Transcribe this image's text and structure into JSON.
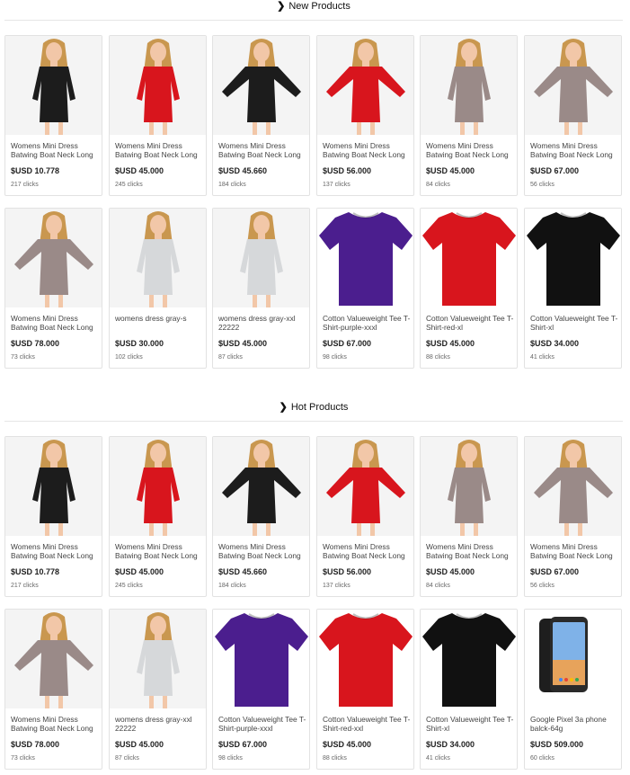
{
  "sections": [
    {
      "title": "New Products",
      "rows": [
        [
          {
            "name": "Womens Mini Dress Batwing Boat Neck Long",
            "price": "$USD 10.778",
            "clicks": "217 clicks",
            "thumb": "dress",
            "color": "#1c1c1c",
            "icon": "black-dress-image"
          },
          {
            "name": "Womens Mini Dress Batwing Boat Neck Long",
            "price": "$USD 45.000",
            "clicks": "245 clicks",
            "thumb": "dress",
            "color": "#d8151d",
            "icon": "red-dress-image"
          },
          {
            "name": "Womens Mini Dress Batwing Boat Neck Long",
            "price": "$USD 45.660",
            "clicks": "184 clicks",
            "thumb": "dress-wide",
            "color": "#1c1c1c",
            "icon": "black-batwing-dress-image"
          },
          {
            "name": "Womens Mini Dress Batwing Boat Neck Long",
            "price": "$USD 56.000",
            "clicks": "137 clicks",
            "thumb": "dress-wide",
            "color": "#d8151d",
            "icon": "red-batwing-dress-image"
          },
          {
            "name": "Womens Mini Dress Batwing Boat Neck Long",
            "price": "$USD 45.000",
            "clicks": "84 clicks",
            "thumb": "dress",
            "color": "#9a8a88",
            "icon": "taupe-dress-image"
          },
          {
            "name": "Womens Mini Dress Batwing Boat Neck Long",
            "price": "$USD 67.000",
            "clicks": "56 clicks",
            "thumb": "dress-wide",
            "color": "#9a8a88",
            "icon": "taupe-batwing-dress-image"
          }
        ],
        [
          {
            "name": "Womens Mini Dress Batwing Boat Neck Long",
            "price": "$USD 78.000",
            "clicks": "73 clicks",
            "thumb": "dress-wide",
            "color": "#9a8a88",
            "icon": "taupe-dress-back-image"
          },
          {
            "name": "womens dress gray-s",
            "price": "$USD 30.000",
            "clicks": "102 clicks",
            "thumb": "dress",
            "color": "#d6d8da",
            "icon": "gray-dress-image"
          },
          {
            "name": "womens dress gray-xxl 22222",
            "price": "$USD 45.000",
            "clicks": "87 clicks",
            "thumb": "dress",
            "color": "#d6d8da",
            "icon": "gray-dress-image"
          },
          {
            "name": "Cotton Valueweight Tee T-Shirt-purple-xxxl",
            "price": "$USD 67.000",
            "clicks": "98 clicks",
            "thumb": "tshirt",
            "color": "#4b1e8e",
            "icon": "purple-tshirt-image"
          },
          {
            "name": "Cotton Valueweight Tee T-Shirt-red-xl",
            "price": "$USD 45.000",
            "clicks": "88 clicks",
            "thumb": "tshirt",
            "color": "#d8151d",
            "icon": "red-tshirt-image"
          },
          {
            "name": "Cotton Valueweight Tee T-Shirt-xl",
            "price": "$USD 34.000",
            "clicks": "41 clicks",
            "thumb": "tshirt",
            "color": "#111111",
            "icon": "black-tshirt-image"
          }
        ]
      ]
    },
    {
      "title": "Hot Products",
      "rows": [
        [
          {
            "name": "Womens Mini Dress Batwing Boat Neck Long",
            "price": "$USD 10.778",
            "clicks": "217 clicks",
            "thumb": "dress",
            "color": "#1c1c1c",
            "icon": "black-dress-image"
          },
          {
            "name": "Womens Mini Dress Batwing Boat Neck Long",
            "price": "$USD 45.000",
            "clicks": "245 clicks",
            "thumb": "dress",
            "color": "#d8151d",
            "icon": "red-dress-image"
          },
          {
            "name": "Womens Mini Dress Batwing Boat Neck Long",
            "price": "$USD 45.660",
            "clicks": "184 clicks",
            "thumb": "dress-wide",
            "color": "#1c1c1c",
            "icon": "black-batwing-dress-image"
          },
          {
            "name": "Womens Mini Dress Batwing Boat Neck Long",
            "price": "$USD 56.000",
            "clicks": "137 clicks",
            "thumb": "dress-wide",
            "color": "#d8151d",
            "icon": "red-batwing-dress-image"
          },
          {
            "name": "Womens Mini Dress Batwing Boat Neck Long",
            "price": "$USD 45.000",
            "clicks": "84 clicks",
            "thumb": "dress",
            "color": "#9a8a88",
            "icon": "taupe-dress-image"
          },
          {
            "name": "Womens Mini Dress Batwing Boat Neck Long",
            "price": "$USD 67.000",
            "clicks": "56 clicks",
            "thumb": "dress-wide",
            "color": "#9a8a88",
            "icon": "taupe-batwing-dress-image"
          }
        ],
        [
          {
            "name": "Womens Mini Dress Batwing Boat Neck Long",
            "price": "$USD 78.000",
            "clicks": "73 clicks",
            "thumb": "dress-wide",
            "color": "#9a8a88",
            "icon": "taupe-dress-back-image"
          },
          {
            "name": "womens dress gray-xxl 22222",
            "price": "$USD 45.000",
            "clicks": "87 clicks",
            "thumb": "dress",
            "color": "#d6d8da",
            "icon": "gray-dress-image"
          },
          {
            "name": "Cotton Valueweight Tee T-Shirt-purple-xxxl",
            "price": "$USD 67.000",
            "clicks": "98 clicks",
            "thumb": "tshirt",
            "color": "#4b1e8e",
            "icon": "purple-tshirt-image"
          },
          {
            "name": "Cotton Valueweight Tee T-Shirt-red-xxl",
            "price": "$USD 45.000",
            "clicks": "88 clicks",
            "thumb": "tshirt",
            "color": "#d8151d",
            "icon": "red-tshirt-image"
          },
          {
            "name": "Cotton Valueweight Tee T-Shirt-xl",
            "price": "$USD 34.000",
            "clicks": "41 clicks",
            "thumb": "tshirt",
            "color": "#111111",
            "icon": "black-tshirt-image"
          },
          {
            "name": "Google Pixel 3a phone balck-64g",
            "price": "$USD 509.000",
            "clicks": "60 clicks",
            "thumb": "phone",
            "color": "#222222",
            "icon": "phone-image"
          }
        ]
      ]
    }
  ]
}
